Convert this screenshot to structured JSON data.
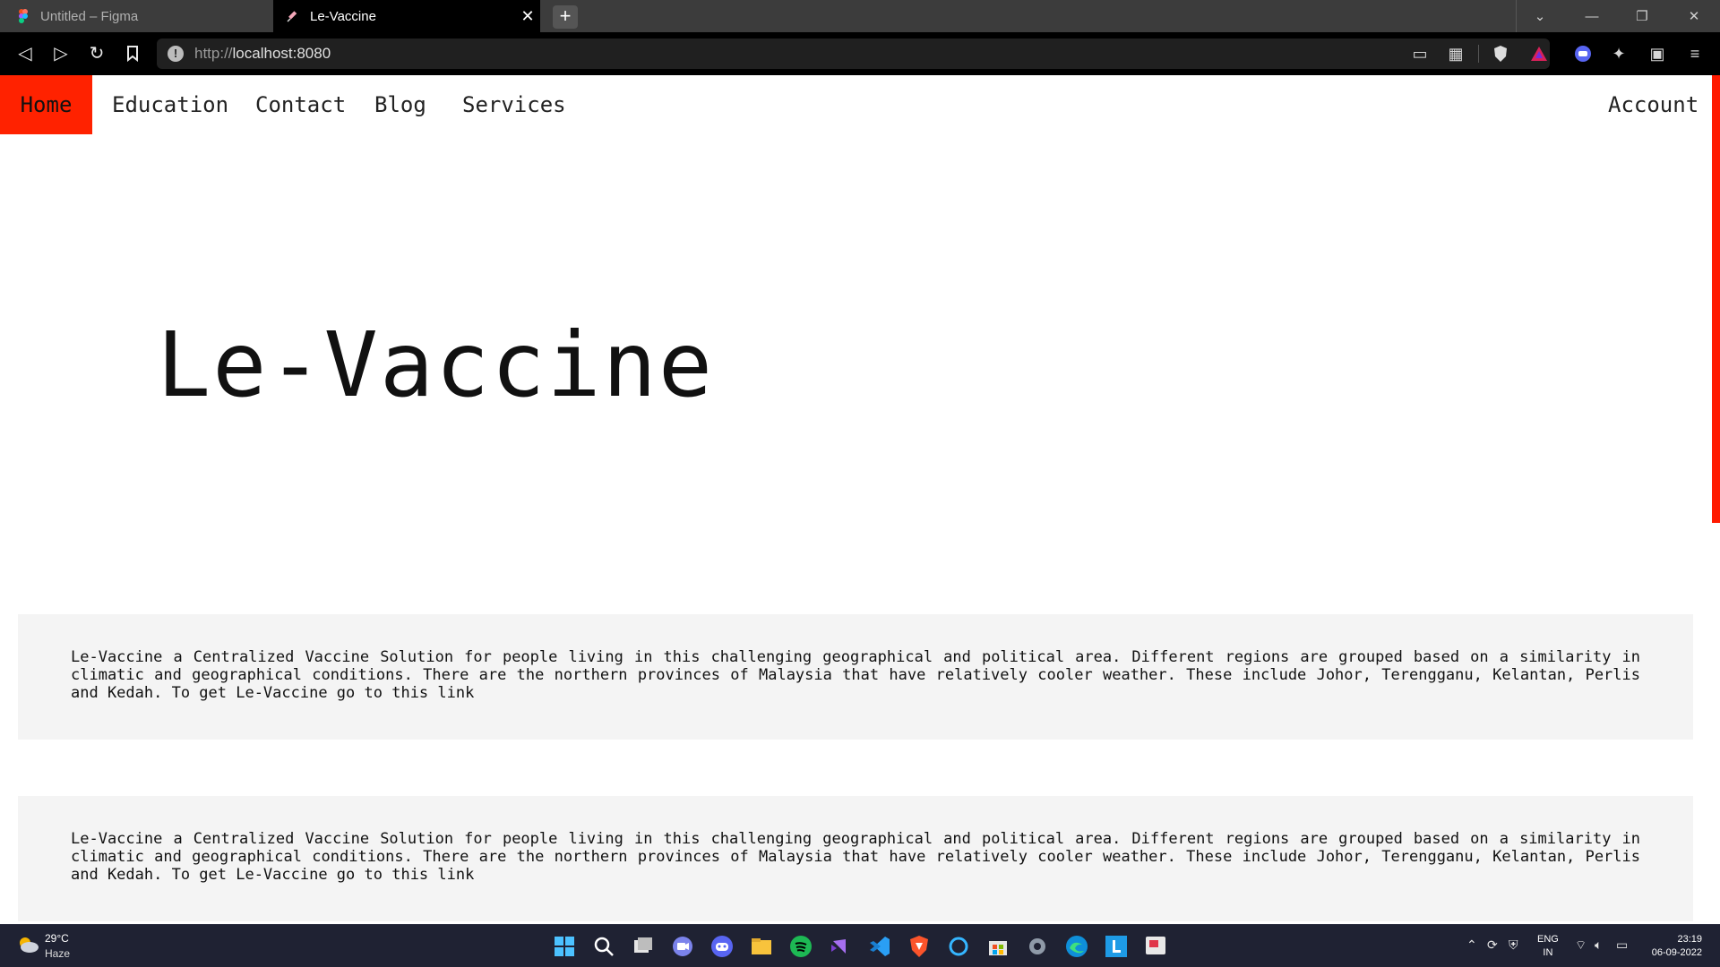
{
  "browser": {
    "tabs": [
      {
        "label": "Untitled – Figma",
        "active": false
      },
      {
        "label": "Le-Vaccine",
        "active": true
      }
    ],
    "url_prefix": "http://",
    "url_host": "localhost:8080"
  },
  "nav": {
    "items": [
      {
        "label": "Home",
        "active": true
      },
      {
        "label": "Education"
      },
      {
        "label": "Contact"
      },
      {
        "label": "Blog"
      },
      {
        "label": "Services"
      }
    ],
    "account_label": "Account",
    "accent_color": "#ff2200"
  },
  "hero": {
    "title": "Le-Vaccine"
  },
  "info_boxes": [
    {
      "text": "Le-Vaccine a Centralized Vaccine Solution for people living in this challenging geographical and political area. Different regions are grouped based on a similarity in climatic and geographical conditions. There are the northern provinces of Malaysia that have relatively cooler weather. These include Johor, Terengganu, Kelantan, Perlis and Kedah. To get Le-Vaccine go to this link"
    },
    {
      "text": "Le-Vaccine a Centralized Vaccine Solution for people living in this challenging geographical and political area. Different regions are grouped based on a similarity in climatic and geographical conditions. There are the northern provinces of Malaysia that have relatively cooler weather. These include Johor, Terengganu, Kelantan, Perlis and Kedah. To get Le-Vaccine go to this link"
    }
  ],
  "taskbar": {
    "weather_temp": "29°C",
    "weather_desc": "Haze",
    "lang_top": "ENG",
    "lang_bottom": "IN",
    "time": "23:19",
    "date": "06-09-2022"
  }
}
